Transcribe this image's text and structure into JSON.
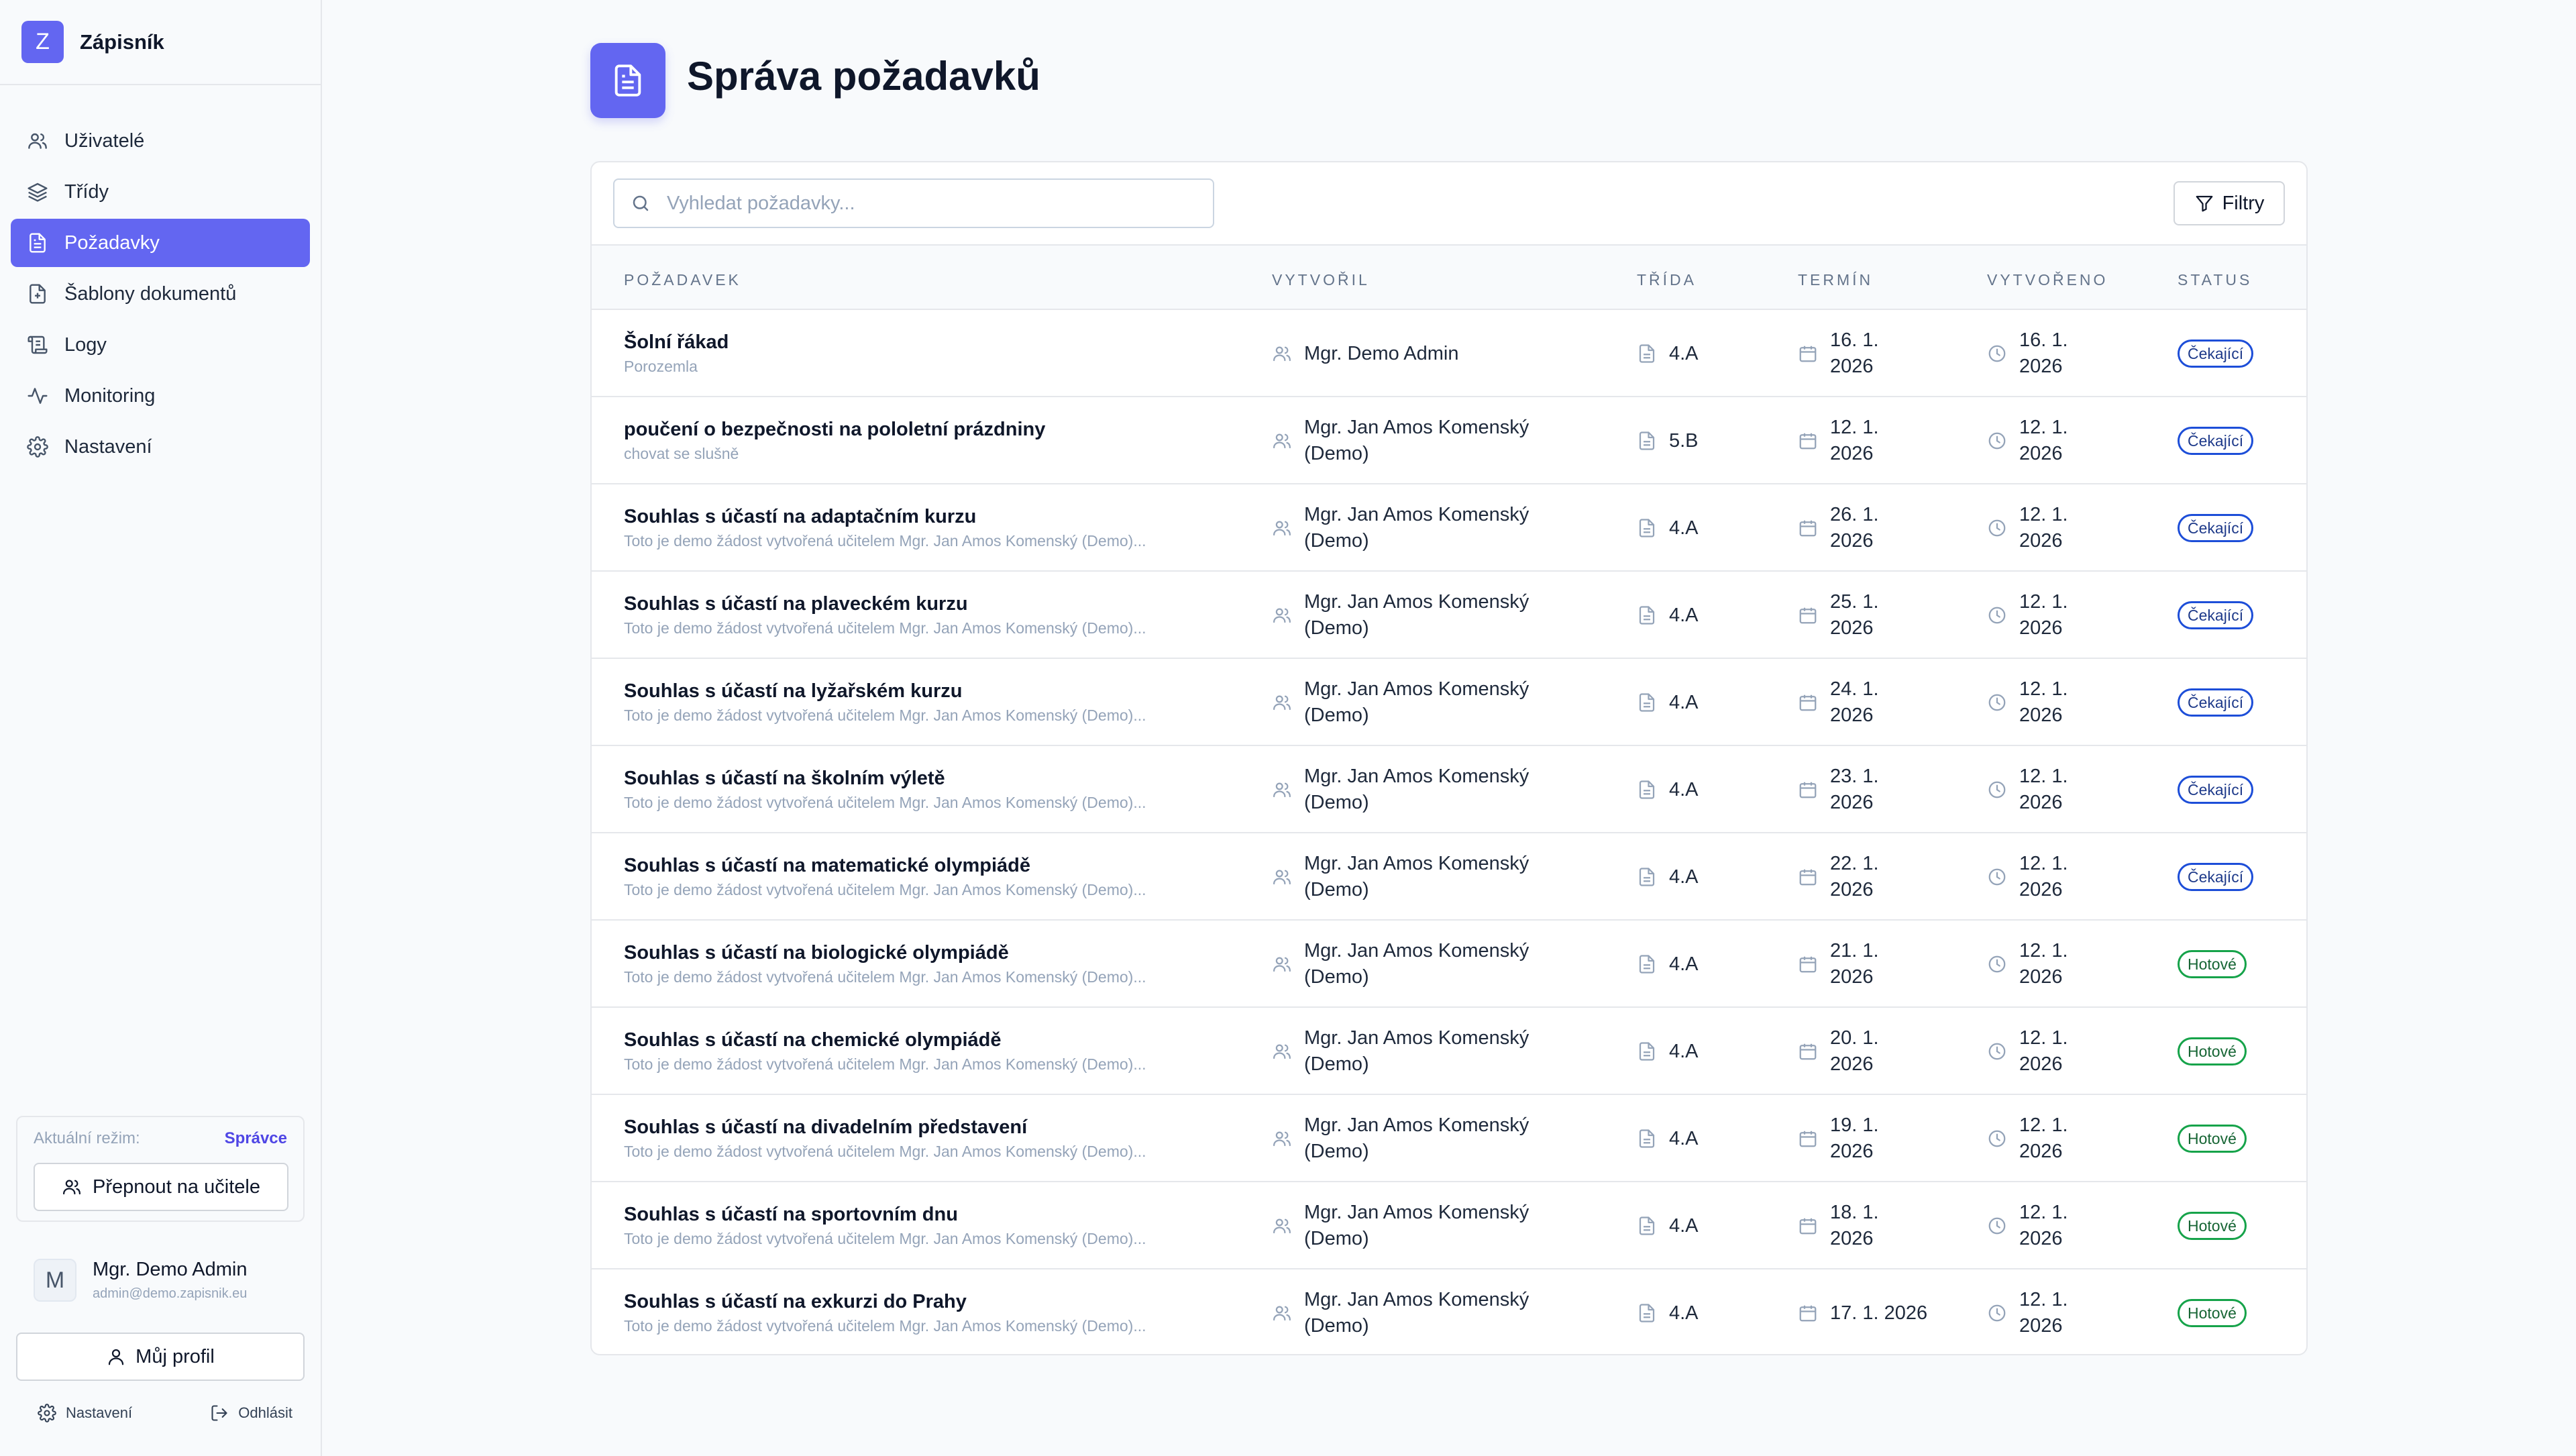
{
  "app": {
    "logo_letter": "Z",
    "name": "Zápisník"
  },
  "sidebar": {
    "items": [
      {
        "label": "Uživatelé",
        "icon": "users-icon"
      },
      {
        "label": "Třídy",
        "icon": "layers-icon"
      },
      {
        "label": "Požadavky",
        "icon": "document-icon",
        "active": true
      },
      {
        "label": "Šablony dokumentů",
        "icon": "file-plus-icon"
      },
      {
        "label": "Logy",
        "icon": "scroll-icon"
      },
      {
        "label": "Monitoring",
        "icon": "activity-icon"
      },
      {
        "label": "Nastavení",
        "icon": "gear-icon"
      }
    ],
    "mode_label": "Aktuální režim:",
    "mode_value": "Správce",
    "switch_label": "Přepnout na učitele",
    "user": {
      "initial": "M",
      "name": "Mgr. Demo Admin",
      "email": "admin@demo.zapisnik.eu"
    },
    "profile_label": "Můj profil",
    "settings_label": "Nastavení",
    "logout_label": "Odhlásit"
  },
  "page": {
    "title": "Správa požadavků"
  },
  "toolbar": {
    "search_placeholder": "Vyhledat požadavky...",
    "filter_label": "Filtry"
  },
  "table": {
    "columns": [
      "POŽADAVEK",
      "VYTVOŘIL",
      "TŘÍDA",
      "TERMÍN",
      "VYTVOŘENO",
      "STATUS"
    ],
    "rows": [
      {
        "title": "Šolní řákad",
        "subtitle": "Porozemla",
        "creator_line1": "Mgr. Demo Admin",
        "creator_line2": "",
        "class": "4.A",
        "deadline_line1": "16. 1.",
        "deadline_line2": "2026",
        "created_line1": "16. 1.",
        "created_line2": "2026",
        "status": "Čekající",
        "status_type": "pending"
      },
      {
        "title": "poučení o bezpečnosti na pololetní prázdniny",
        "subtitle": "chovat se slušně",
        "creator_line1": "Mgr. Jan Amos Komenský",
        "creator_line2": "(Demo)",
        "class": "5.B",
        "deadline_line1": "12. 1.",
        "deadline_line2": "2026",
        "created_line1": "12. 1.",
        "created_line2": "2026",
        "status": "Čekající",
        "status_type": "pending"
      },
      {
        "title": "Souhlas s účastí na adaptačním kurzu",
        "subtitle": "Toto je demo žádost vytvořená učitelem Mgr. Jan Amos Komenský (Demo)...",
        "creator_line1": "Mgr. Jan Amos Komenský",
        "creator_line2": "(Demo)",
        "class": "4.A",
        "deadline_line1": "26. 1.",
        "deadline_line2": "2026",
        "created_line1": "12. 1.",
        "created_line2": "2026",
        "status": "Čekající",
        "status_type": "pending"
      },
      {
        "title": "Souhlas s účastí na plaveckém kurzu",
        "subtitle": "Toto je demo žádost vytvořená učitelem Mgr. Jan Amos Komenský (Demo)...",
        "creator_line1": "Mgr. Jan Amos Komenský",
        "creator_line2": "(Demo)",
        "class": "4.A",
        "deadline_line1": "25. 1.",
        "deadline_line2": "2026",
        "created_line1": "12. 1.",
        "created_line2": "2026",
        "status": "Čekající",
        "status_type": "pending"
      },
      {
        "title": "Souhlas s účastí na lyžařském kurzu",
        "subtitle": "Toto je demo žádost vytvořená učitelem Mgr. Jan Amos Komenský (Demo)...",
        "creator_line1": "Mgr. Jan Amos Komenský",
        "creator_line2": "(Demo)",
        "class": "4.A",
        "deadline_line1": "24. 1.",
        "deadline_line2": "2026",
        "created_line1": "12. 1.",
        "created_line2": "2026",
        "status": "Čekající",
        "status_type": "pending"
      },
      {
        "title": "Souhlas s účastí na školním výletě",
        "subtitle": "Toto je demo žádost vytvořená učitelem Mgr. Jan Amos Komenský (Demo)...",
        "creator_line1": "Mgr. Jan Amos Komenský",
        "creator_line2": "(Demo)",
        "class": "4.A",
        "deadline_line1": "23. 1.",
        "deadline_line2": "2026",
        "created_line1": "12. 1.",
        "created_line2": "2026",
        "status": "Čekající",
        "status_type": "pending"
      },
      {
        "title": "Souhlas s účastí na matematické olympiádě",
        "subtitle": "Toto je demo žádost vytvořená učitelem Mgr. Jan Amos Komenský (Demo)...",
        "creator_line1": "Mgr. Jan Amos Komenský",
        "creator_line2": "(Demo)",
        "class": "4.A",
        "deadline_line1": "22. 1.",
        "deadline_line2": "2026",
        "created_line1": "12. 1.",
        "created_line2": "2026",
        "status": "Čekající",
        "status_type": "pending"
      },
      {
        "title": "Souhlas s účastí na biologické olympiádě",
        "subtitle": "Toto je demo žádost vytvořená učitelem Mgr. Jan Amos Komenský (Demo)...",
        "creator_line1": "Mgr. Jan Amos Komenský",
        "creator_line2": "(Demo)",
        "class": "4.A",
        "deadline_line1": "21. 1.",
        "deadline_line2": "2026",
        "created_line1": "12. 1.",
        "created_line2": "2026",
        "status": "Hotové",
        "status_type": "done"
      },
      {
        "title": "Souhlas s účastí na chemické olympiádě",
        "subtitle": "Toto je demo žádost vytvořená učitelem Mgr. Jan Amos Komenský (Demo)...",
        "creator_line1": "Mgr. Jan Amos Komenský",
        "creator_line2": "(Demo)",
        "class": "4.A",
        "deadline_line1": "20. 1.",
        "deadline_line2": "2026",
        "created_line1": "12. 1.",
        "created_line2": "2026",
        "status": "Hotové",
        "status_type": "done"
      },
      {
        "title": "Souhlas s účastí na divadelním představení",
        "subtitle": "Toto je demo žádost vytvořená učitelem Mgr. Jan Amos Komenský (Demo)...",
        "creator_line1": "Mgr. Jan Amos Komenský",
        "creator_line2": "(Demo)",
        "class": "4.A",
        "deadline_line1": "19. 1.",
        "deadline_line2": "2026",
        "created_line1": "12. 1.",
        "created_line2": "2026",
        "status": "Hotové",
        "status_type": "done"
      },
      {
        "title": "Souhlas s účastí na sportovním dnu",
        "subtitle": "Toto je demo žádost vytvořená učitelem Mgr. Jan Amos Komenský (Demo)...",
        "creator_line1": "Mgr. Jan Amos Komenský",
        "creator_line2": "(Demo)",
        "class": "4.A",
        "deadline_line1": "18. 1.",
        "deadline_line2": "2026",
        "created_line1": "12. 1.",
        "created_line2": "2026",
        "status": "Hotové",
        "status_type": "done"
      },
      {
        "title": "Souhlas s účastí na exkurzi do Prahy",
        "subtitle": "Toto je demo žádost vytvořená učitelem Mgr. Jan Amos Komenský (Demo)...",
        "creator_line1": "Mgr. Jan Amos Komenský",
        "creator_line2": "(Demo)",
        "class": "4.A",
        "deadline_line1": "17. 1. 2026",
        "deadline_line2": "",
        "created_line1": "12. 1.",
        "created_line2": "2026",
        "status": "Hotové",
        "status_type": "done"
      }
    ]
  },
  "colors": {
    "accent": "#6366f1",
    "pending": "#1d4ed8",
    "done": "#16a34a"
  }
}
